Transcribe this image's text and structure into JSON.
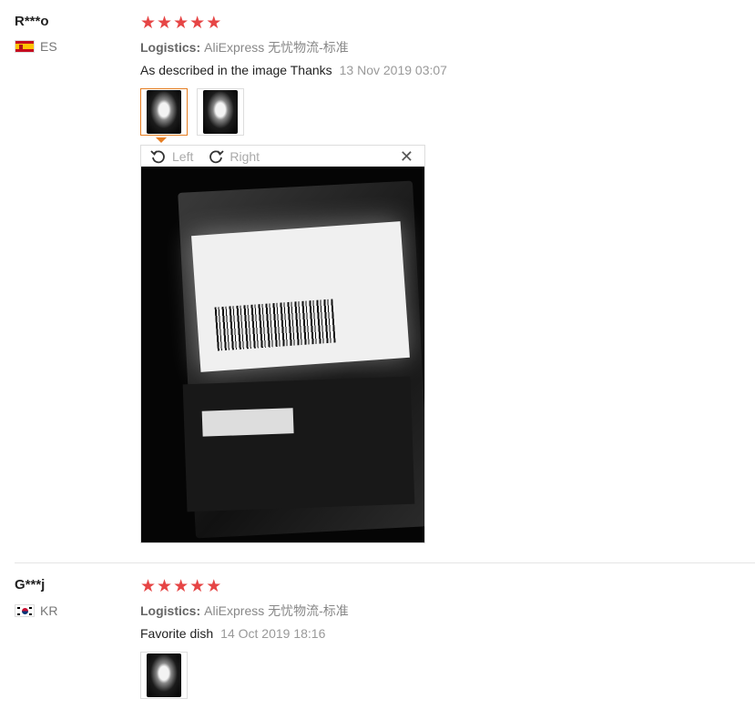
{
  "reviews": [
    {
      "user": "R***o",
      "country_code": "ES",
      "stars": [
        "★",
        "★",
        "★",
        "★",
        "★"
      ],
      "logistics_label": "Logistics:",
      "logistics_value": "AliExpress 无忧物流-标准",
      "comment": "As described in the image Thanks",
      "date": "13 Nov 2019 03:07"
    },
    {
      "user": "G***j",
      "country_code": "KR",
      "stars": [
        "★",
        "★",
        "★",
        "★",
        "★"
      ],
      "logistics_label": "Logistics:",
      "logistics_value": "AliExpress 无忧物流-标准",
      "comment": "Favorite dish",
      "date": "14 Oct 2019 18:16"
    }
  ],
  "viewer": {
    "rotate_left": "Left",
    "rotate_right": "Right",
    "close": "✕"
  },
  "colors": {
    "star": "#e64545",
    "active_thumb": "#e67e22"
  }
}
